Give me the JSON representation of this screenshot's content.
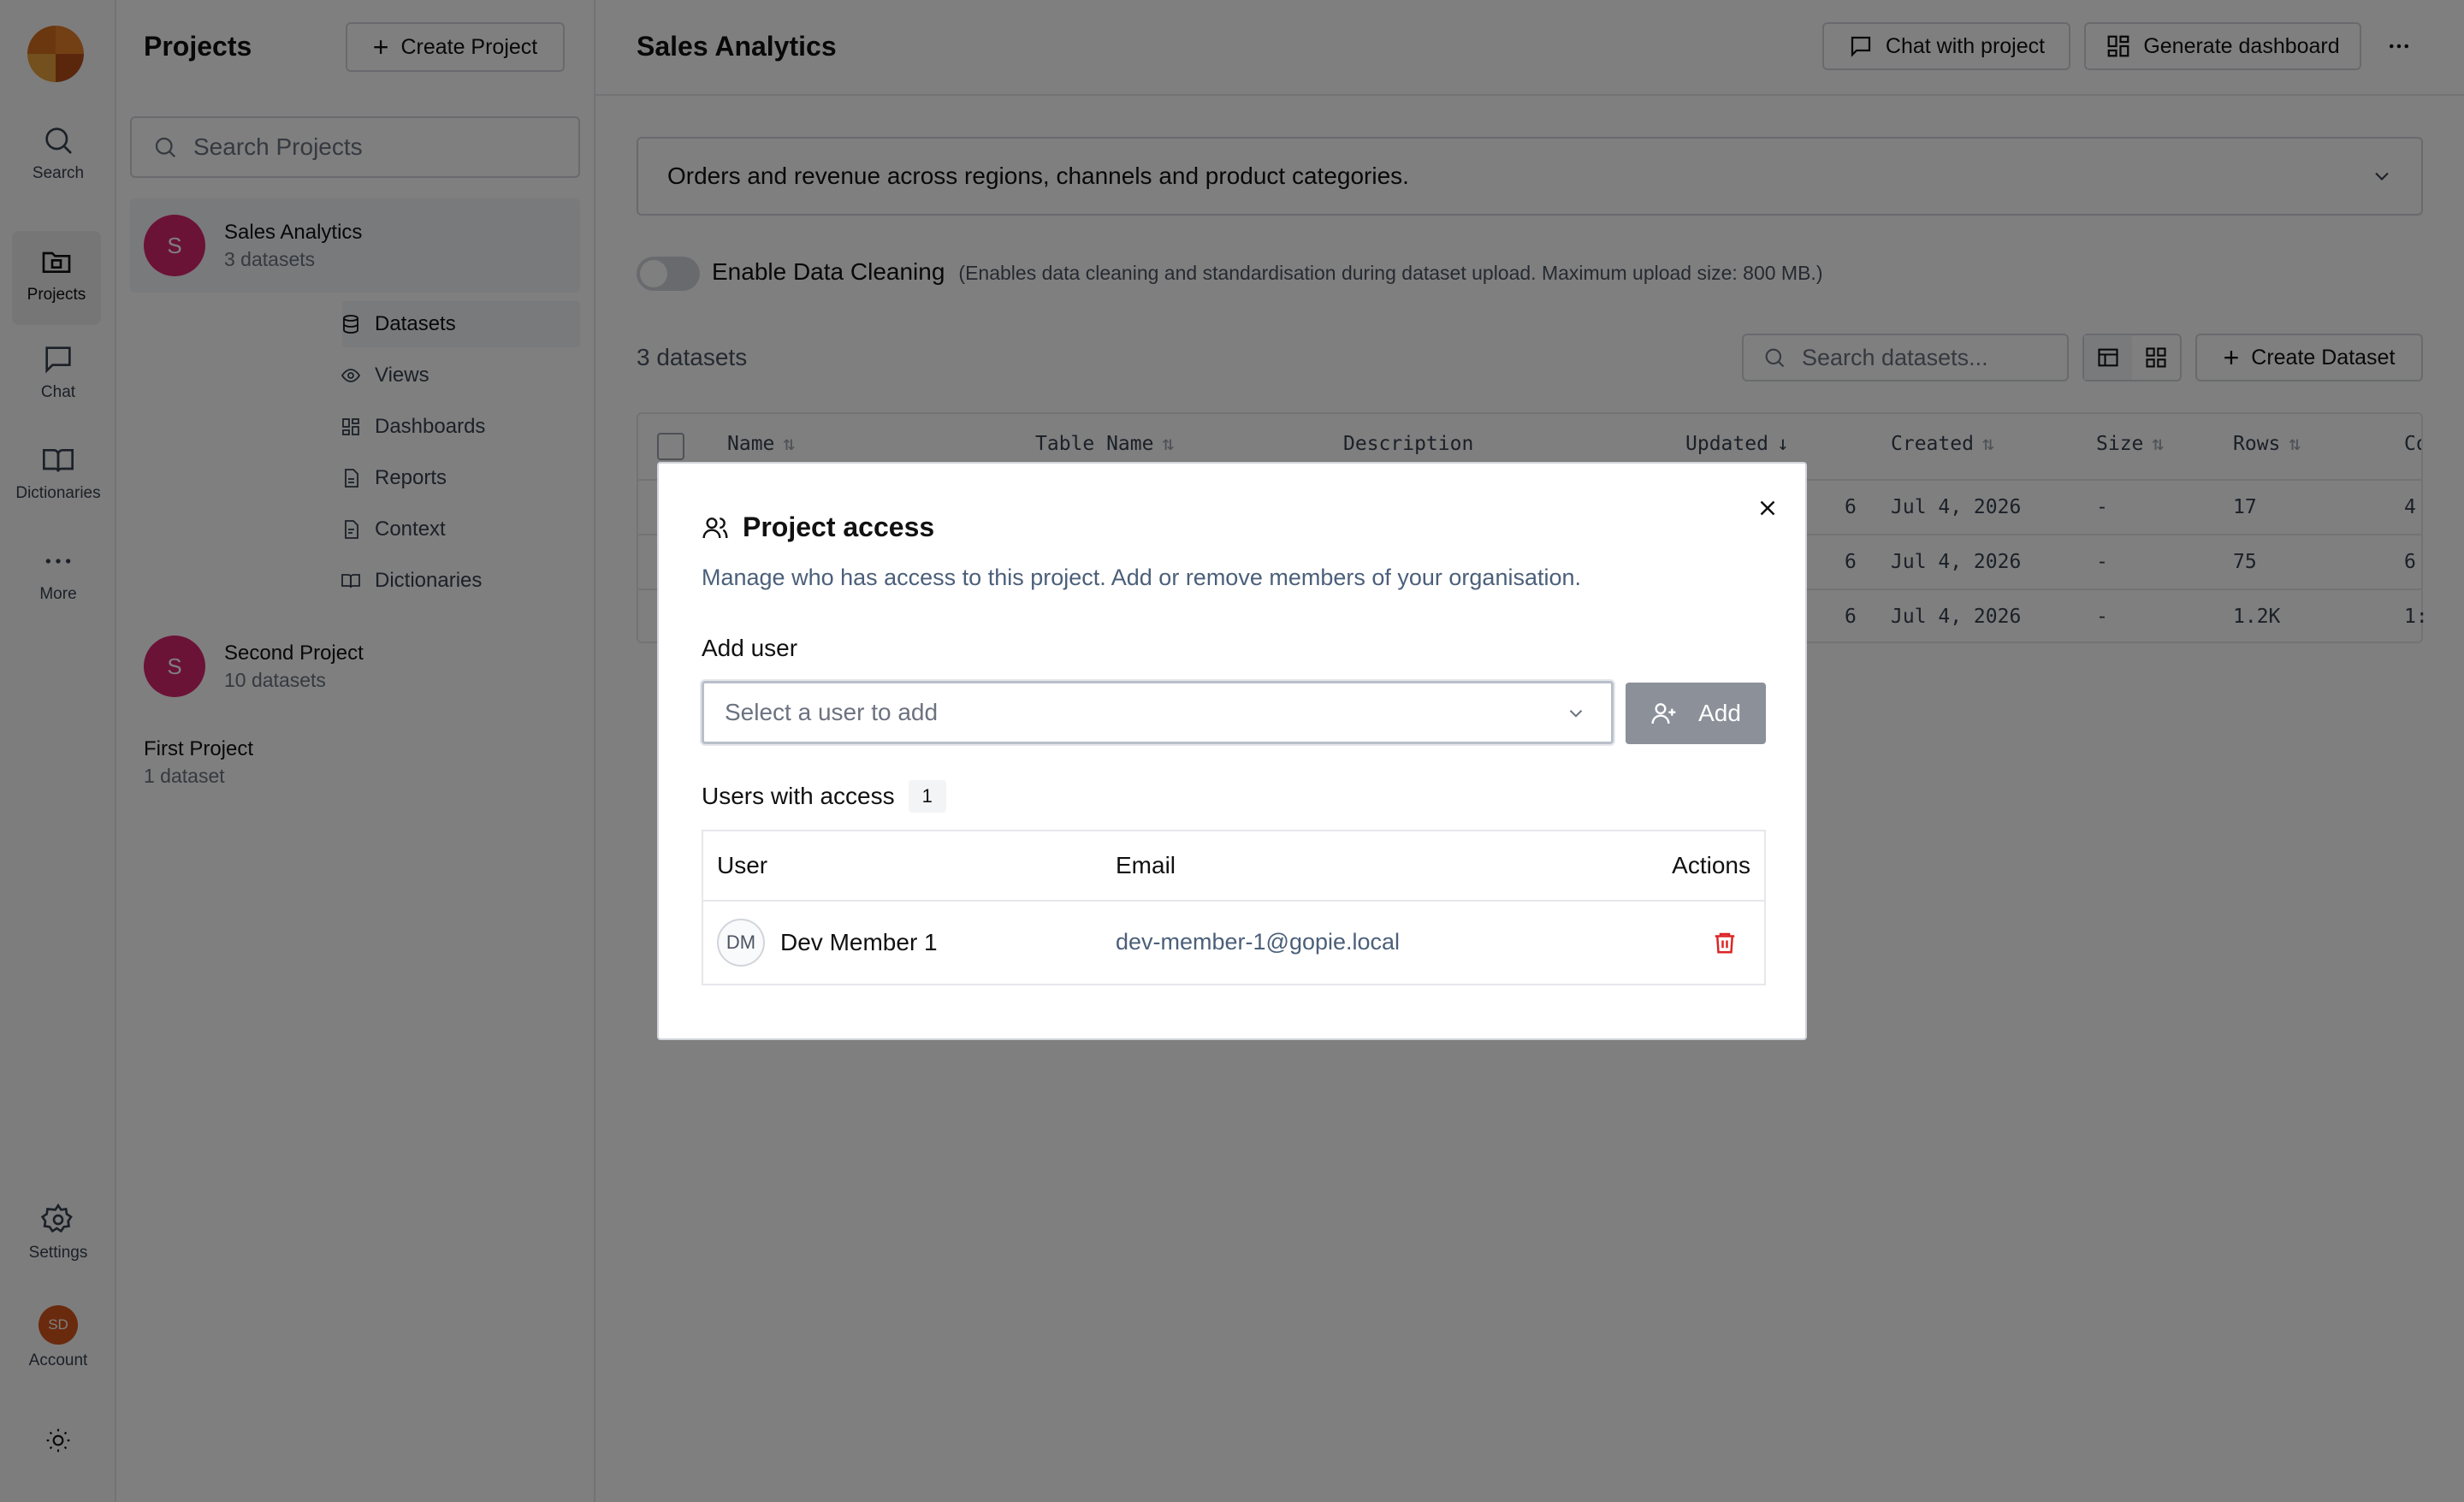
{
  "rail": {
    "items": [
      {
        "label": "Search"
      },
      {
        "label": "Projects"
      },
      {
        "label": "Chat"
      },
      {
        "label": "Dictionaries"
      },
      {
        "label": "More"
      },
      {
        "label": "Settings"
      },
      {
        "label": "Account"
      }
    ],
    "account_initials": "SD"
  },
  "panel": {
    "title": "Projects",
    "create_label": "Create Project",
    "search_placeholder": "Search Projects",
    "projects": [
      {
        "initial": "S",
        "name": "Sales Analytics",
        "sub": "3 datasets"
      },
      {
        "initial": "S",
        "name": "Second Project",
        "sub": "10 datasets"
      },
      {
        "name": "First Project",
        "sub": "1 dataset"
      }
    ],
    "subnav": [
      "Datasets",
      "Views",
      "Dashboards",
      "Reports",
      "Context",
      "Dictionaries"
    ]
  },
  "main": {
    "title": "Sales Analytics",
    "chat_label": "Chat with project",
    "generate_label": "Generate dashboard",
    "description": "Orders and revenue across regions, channels and product categories.",
    "cleaning_label": "Enable Data Cleaning",
    "cleaning_note": "(Enables data cleaning and standardisation during dataset upload. Maximum upload size: 800 MB.)",
    "dataset_count": "3 datasets",
    "search_placeholder": "Search datasets...",
    "create_dataset_label": "Create Dataset",
    "columns": [
      "Name",
      "Table Name",
      "Description",
      "Updated",
      "Created",
      "Size",
      "Rows",
      "Co"
    ],
    "rows": [
      {
        "updated": "6",
        "created": "Jul 4, 2026",
        "size": "-",
        "rows": "17",
        "co": "4"
      },
      {
        "updated": "6",
        "created": "Jul 4, 2026",
        "size": "-",
        "rows": "75",
        "co": "6"
      },
      {
        "updated": "6",
        "created": "Jul 4, 2026",
        "size": "-",
        "rows": "1.2K",
        "co": "1:"
      }
    ]
  },
  "modal": {
    "title": "Project access",
    "subtitle": "Manage who has access to this project. Add or remove members of your organisation.",
    "add_user_label": "Add user",
    "select_placeholder": "Select a user to add",
    "add_button": "Add",
    "users_label": "Users with access",
    "users_count": "1",
    "headers": {
      "user": "User",
      "email": "Email",
      "actions": "Actions"
    },
    "users": [
      {
        "initials": "DM",
        "name": "Dev Member 1",
        "email": "dev-member-1@gopie.local"
      }
    ]
  }
}
